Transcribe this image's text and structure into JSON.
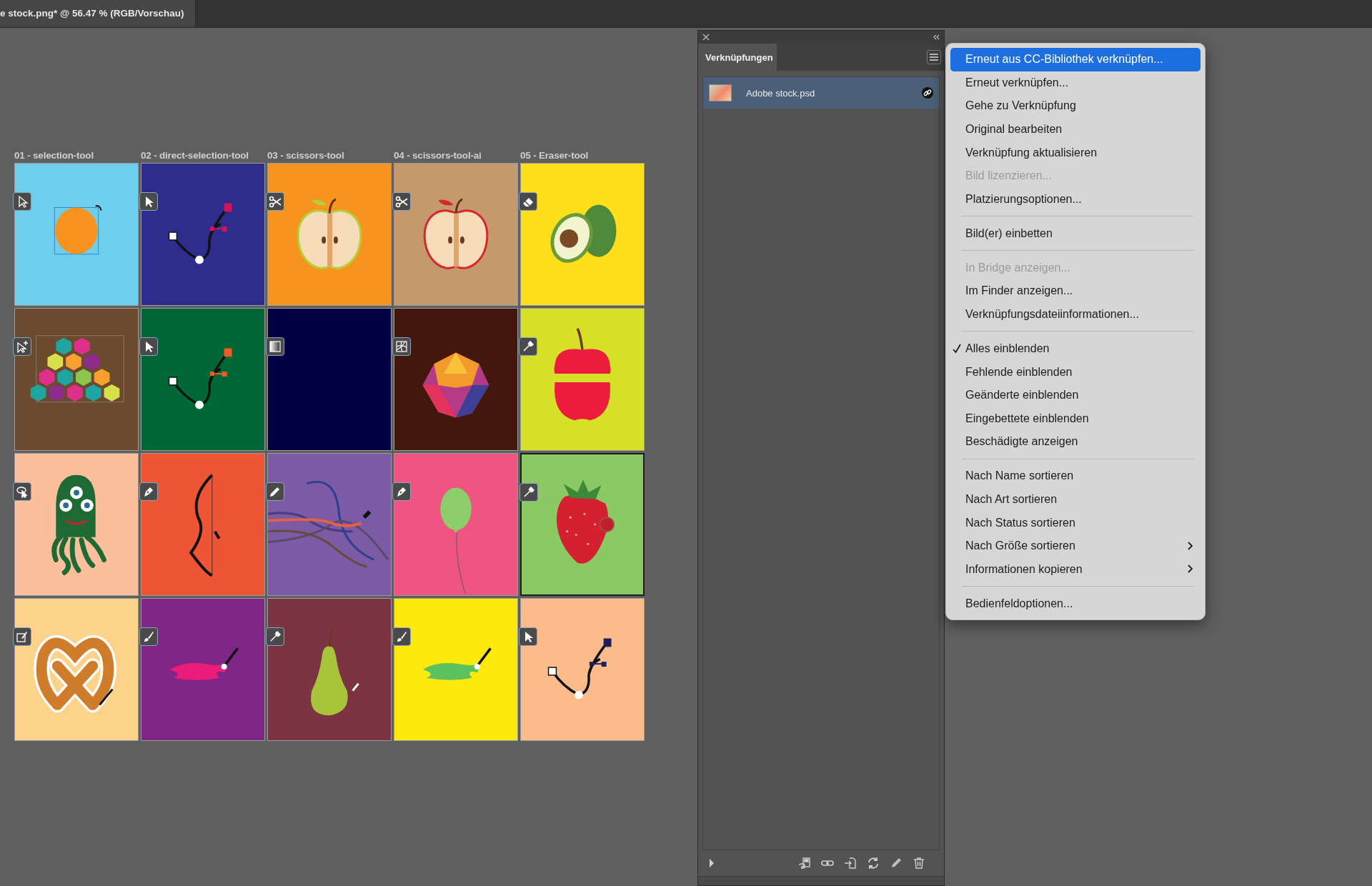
{
  "document_tab": {
    "title": "e stock.png* @ 56.47 % (RGB/Vorschau)"
  },
  "artboards": [
    {
      "label": "01 - selection-tool",
      "color": "#6dcfec",
      "selected": false,
      "badge": {
        "kind": "arrow-outline"
      },
      "art": {
        "kind": "circle",
        "color": "#f7931e"
      }
    },
    {
      "label": "02 - direct-selection-tool",
      "color": "#2e2c8c",
      "selected": false,
      "badge": {
        "kind": "arrow"
      },
      "art": {
        "kind": "path",
        "color": "#d4145a"
      }
    },
    {
      "label": "03 - scissors-tool",
      "color": "#f7941d",
      "selected": false,
      "badge": {
        "kind": "scissors"
      },
      "art": {
        "kind": "apple-half",
        "color": "#b5cf3c"
      }
    },
    {
      "label": "04 - scissors-tool-ai",
      "color": "#c49a6c",
      "selected": false,
      "badge": {
        "kind": "scissors"
      },
      "art": {
        "kind": "apple-half",
        "color": "#d7262b"
      }
    },
    {
      "label": "05 - Eraser-tool",
      "color": "#fddf1c",
      "selected": false,
      "badge": {
        "kind": "eraser"
      },
      "art": {
        "kind": "avocado"
      }
    },
    {
      "color": "#6b4a2e",
      "selected": false,
      "badge": {
        "kind": "arrow-plus"
      },
      "art": {
        "kind": "hexagons"
      }
    },
    {
      "color": "#006837",
      "selected": false,
      "badge": {
        "kind": "arrow"
      },
      "art": {
        "kind": "path",
        "color": "#f15a24"
      }
    },
    {
      "color": "#000043",
      "selected": false,
      "badge": {
        "kind": "gradient"
      }
    },
    {
      "color": "#42180d",
      "selected": false,
      "badge": {
        "kind": "mesh"
      },
      "art": {
        "kind": "gem"
      }
    },
    {
      "color": "#d7e028",
      "selected": false,
      "badge": {
        "kind": "eyedropper"
      },
      "art": {
        "kind": "apple-sliced"
      }
    },
    {
      "color": "#fbbf9c",
      "selected": false,
      "badge": {
        "kind": "lasso"
      },
      "art": {
        "kind": "monster"
      }
    },
    {
      "color": "#ed5535",
      "selected": false,
      "badge": {
        "kind": "pen"
      },
      "art": {
        "kind": "bow"
      }
    },
    {
      "color": "#7b5aa6",
      "selected": false,
      "badge": {
        "kind": "pencil"
      },
      "art": {
        "kind": "lines"
      }
    },
    {
      "color": "#ef5482",
      "selected": false,
      "badge": {
        "kind": "pen"
      },
      "art": {
        "kind": "balloon"
      }
    },
    {
      "color": "#8cc864",
      "selected": true,
      "badge": {
        "kind": "eyedropper"
      },
      "art": {
        "kind": "strawberry"
      }
    },
    {
      "color": "#fdd38c",
      "selected": false,
      "badge": {
        "kind": "blob-brush"
      },
      "art": {
        "kind": "pretzel"
      }
    },
    {
      "color": "#7f2686",
      "selected": false,
      "badge": {
        "kind": "brush"
      },
      "art": {
        "kind": "brush-stroke",
        "color": "#ec1c7a"
      }
    },
    {
      "color": "#7d3442",
      "selected": false,
      "badge": {
        "kind": "eyedropper"
      },
      "art": {
        "kind": "pear"
      }
    },
    {
      "color": "#fde90c",
      "selected": false,
      "badge": {
        "kind": "brush"
      },
      "art": {
        "kind": "brush-stroke",
        "color": "#5cc15f"
      }
    },
    {
      "color": "#fbbb8a",
      "selected": false,
      "badge": {
        "kind": "arrow"
      },
      "art": {
        "kind": "path",
        "color": "#1b1f5e"
      }
    }
  ],
  "links_panel": {
    "title": "Verknüpfungen",
    "links": [
      {
        "name": "Adobe stock.psd",
        "selected": true
      }
    ]
  },
  "context_menu": {
    "items": [
      {
        "kind": "item",
        "label": "Erneut aus CC-Bibliothek verknüpfen...",
        "selected": true,
        "disabled": false,
        "checked": false,
        "submenu": false
      },
      {
        "kind": "item",
        "label": "Erneut verknüpfen...",
        "selected": false,
        "disabled": false,
        "checked": false,
        "submenu": false
      },
      {
        "kind": "item",
        "label": "Gehe zu Verknüpfung",
        "selected": false,
        "disabled": false,
        "checked": false,
        "submenu": false
      },
      {
        "kind": "item",
        "label": "Original bearbeiten",
        "selected": false,
        "disabled": false,
        "checked": false,
        "submenu": false
      },
      {
        "kind": "item",
        "label": "Verknüpfung aktualisieren",
        "selected": false,
        "disabled": false,
        "checked": false,
        "submenu": false
      },
      {
        "kind": "item",
        "label": "Bild lizenzieren...",
        "selected": false,
        "disabled": true,
        "checked": false,
        "submenu": false
      },
      {
        "kind": "item",
        "label": "Platzierungsoptionen...",
        "selected": false,
        "disabled": false,
        "checked": false,
        "submenu": false
      },
      {
        "kind": "separator"
      },
      {
        "kind": "item",
        "label": "Bild(er) einbetten",
        "selected": false,
        "disabled": false,
        "checked": false,
        "submenu": false
      },
      {
        "kind": "separator"
      },
      {
        "kind": "item",
        "label": "In Bridge anzeigen...",
        "selected": false,
        "disabled": true,
        "checked": false,
        "submenu": false
      },
      {
        "kind": "item",
        "label": "Im Finder anzeigen...",
        "selected": false,
        "disabled": false,
        "checked": false,
        "submenu": false
      },
      {
        "kind": "item",
        "label": "Verknüpfungsdateiinformationen...",
        "selected": false,
        "disabled": false,
        "checked": false,
        "submenu": false
      },
      {
        "kind": "separator"
      },
      {
        "kind": "item",
        "label": "Alles einblenden",
        "selected": false,
        "disabled": false,
        "checked": true,
        "submenu": false
      },
      {
        "kind": "item",
        "label": "Fehlende einblenden",
        "selected": false,
        "disabled": false,
        "checked": false,
        "submenu": false
      },
      {
        "kind": "item",
        "label": "Geänderte einblenden",
        "selected": false,
        "disabled": false,
        "checked": false,
        "submenu": false
      },
      {
        "kind": "item",
        "label": "Eingebettete einblenden",
        "selected": false,
        "disabled": false,
        "checked": false,
        "submenu": false
      },
      {
        "kind": "item",
        "label": "Beschädigte anzeigen",
        "selected": false,
        "disabled": false,
        "checked": false,
        "submenu": false
      },
      {
        "kind": "separator"
      },
      {
        "kind": "item",
        "label": "Nach Name sortieren",
        "selected": false,
        "disabled": false,
        "checked": false,
        "submenu": false
      },
      {
        "kind": "item",
        "label": "Nach Art sortieren",
        "selected": false,
        "disabled": false,
        "checked": false,
        "submenu": false
      },
      {
        "kind": "item",
        "label": "Nach Status sortieren",
        "selected": false,
        "disabled": false,
        "checked": false,
        "submenu": false
      },
      {
        "kind": "item",
        "label": "Nach Größe sortieren",
        "selected": false,
        "disabled": false,
        "checked": false,
        "submenu": true
      },
      {
        "kind": "item",
        "label": "Informationen kopieren",
        "selected": false,
        "disabled": false,
        "checked": false,
        "submenu": true
      },
      {
        "kind": "separator"
      },
      {
        "kind": "item",
        "label": "Bedienfeldoptionen...",
        "selected": false,
        "disabled": false,
        "checked": false,
        "submenu": false
      }
    ]
  }
}
